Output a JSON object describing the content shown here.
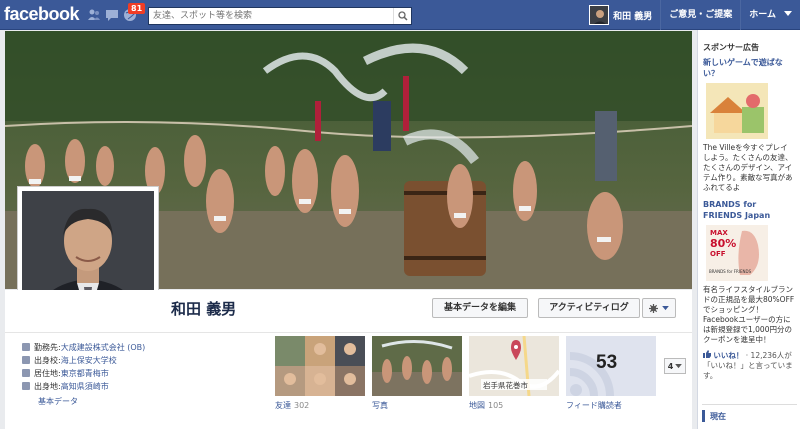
{
  "topbar": {
    "logo": "facebook",
    "notification_count": "81",
    "search_placeholder": "友達、スポット等を検索",
    "user_name": "和田 義男",
    "links": [
      "ご意見・ご提案",
      "ホーム"
    ]
  },
  "profile": {
    "name": "和田 義男",
    "edit_button": "基本データを編集",
    "activity_button": "アクティビティログ",
    "info": [
      {
        "key": "勤務先: ",
        "value": "大成建設株式会社 (OB)"
      },
      {
        "key": "出身校: ",
        "value": "海上保安大学校"
      },
      {
        "key": "居住地: ",
        "value": "東京都青梅市"
      },
      {
        "key": "出身地: ",
        "value": "高知県須崎市"
      }
    ],
    "basic_data_link": "基本データ"
  },
  "tiles": [
    {
      "label": "友達",
      "count": "302"
    },
    {
      "label": "写真",
      "count": ""
    },
    {
      "label": "地図",
      "count": "105",
      "map_label": "岩手県花巻市"
    },
    {
      "label": "フィード購読者",
      "count": "",
      "number": "53"
    }
  ],
  "more_button": "4",
  "sidebar": {
    "header": "スポンサー広告",
    "ad1_title": "新しいゲームで遊ばない？",
    "ad1_body": "The Villeを今すぐプレイしよう。たくさんの友達、たくさんのデザイン、アイテム作り。素敵な写真があふれてるよ",
    "ad2_title": "BRANDS for FRIENDS Japan",
    "ad2_img_text": [
      "MAX",
      "80%",
      "OFF",
      "BRANDS for FRIENDS"
    ],
    "ad2_body": "有名ライフスタイルブランドの正規品を最大80%OFFでショッピング！Facebookユーザーの方には新規登録で1,000円分のクーポンを進呈中！",
    "ad2_like": "いいね！",
    "ad2_like_text": "· 12,236人が「いいね！」と言っています。",
    "now": "現在"
  },
  "colors": {
    "brand": "#3b5998",
    "badge": "#f03d25"
  }
}
